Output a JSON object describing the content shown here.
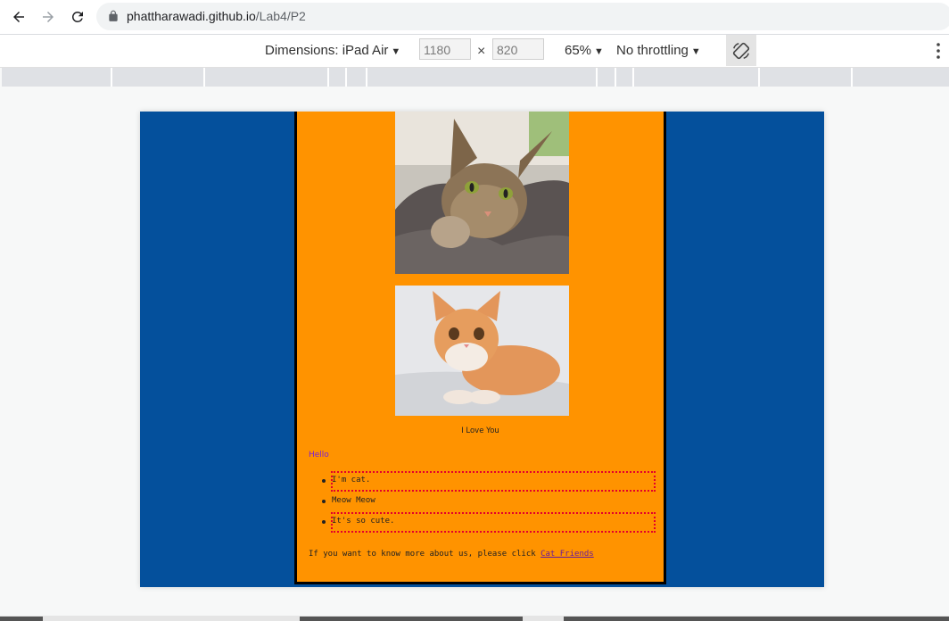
{
  "browser": {
    "url_host": "phattharawadi.github.io",
    "url_path": "/Lab4/P2",
    "back_icon": "arrow-left-icon",
    "forward_icon": "arrow-right-icon",
    "reload_icon": "reload-icon"
  },
  "device_toolbar": {
    "dimensions_label": "Dimensions: iPad Air",
    "width_value": "1180",
    "height_value": "820",
    "times_symbol": "×",
    "zoom_label": "65%",
    "throttling_label": "No throttling",
    "rotate_icon": "rotate-icon",
    "more_icon": "more-vertical-icon"
  },
  "page": {
    "colors": {
      "background": "#04509c",
      "content_bg": "#ff9300",
      "hello": "#7a1fd6",
      "dotted_border": "#e3002b",
      "link": "#6a1b9a"
    },
    "image1_alt": "tabby cat photo",
    "image2_alt": "orange kitten photo",
    "caption": "I Love You",
    "hello": "Hello",
    "list_items": [
      "I'm cat.",
      "Meow Meow",
      "It's so cute."
    ],
    "more_text": "If you want to know more about us, please click ",
    "link_text": "Cat Friends"
  }
}
